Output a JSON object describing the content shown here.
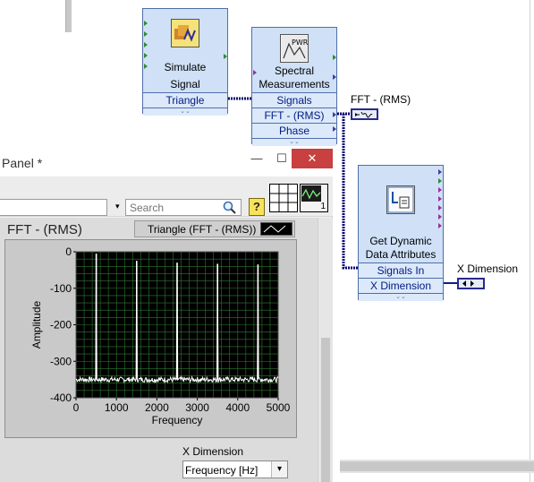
{
  "nodes": {
    "simulate": {
      "line1": "Simulate",
      "line2": "Signal",
      "terminal": "Triangle"
    },
    "spectral": {
      "line1": "Spectral",
      "line2": "Measurements",
      "terminals": [
        "Signals",
        "FFT - (RMS)",
        "Phase"
      ],
      "icon_text": "PWR"
    },
    "dynamic": {
      "line1": "Get Dynamic",
      "line2": "Data Attributes",
      "terminals": [
        "Signals In",
        "X Dimension"
      ]
    }
  },
  "indicators": {
    "fft_label": "FFT - (RMS)",
    "xdim_label": "X Dimension"
  },
  "front_panel": {
    "title": "Panel *",
    "window_buttons": {
      "minimize": "—",
      "maximize": "☐",
      "close": "✕"
    },
    "search_placeholder": "Search",
    "help": "?",
    "palette_badge": "1",
    "graph_label": "FFT - (RMS)",
    "legend_label": "Triangle (FFT - (RMS))",
    "xdim_control_label": "X Dimension",
    "xdim_value": "Frequency [Hz]"
  },
  "chart_data": {
    "type": "line",
    "xlabel": "Frequency",
    "ylabel": "Amplitude",
    "xlim": [
      0,
      5000
    ],
    "ylim": [
      -400,
      0
    ],
    "xticks": [
      "0",
      "1000",
      "2000",
      "3000",
      "4000",
      "5000"
    ],
    "yticks": [
      "0",
      "-100",
      "-200",
      "-300",
      "-400"
    ],
    "series": [
      {
        "name": "Triangle (FFT - (RMS))",
        "color": "#ffffff",
        "noise_floor": -350,
        "peaks": [
          {
            "x": 500,
            "y": -5
          },
          {
            "x": 1500,
            "y": -25
          },
          {
            "x": 2500,
            "y": -30
          },
          {
            "x": 3500,
            "y": -33
          },
          {
            "x": 4500,
            "y": -35
          }
        ]
      }
    ],
    "grid": true,
    "colors": {
      "plot_bg": "#000000",
      "grid": "#2f7a2f"
    }
  }
}
